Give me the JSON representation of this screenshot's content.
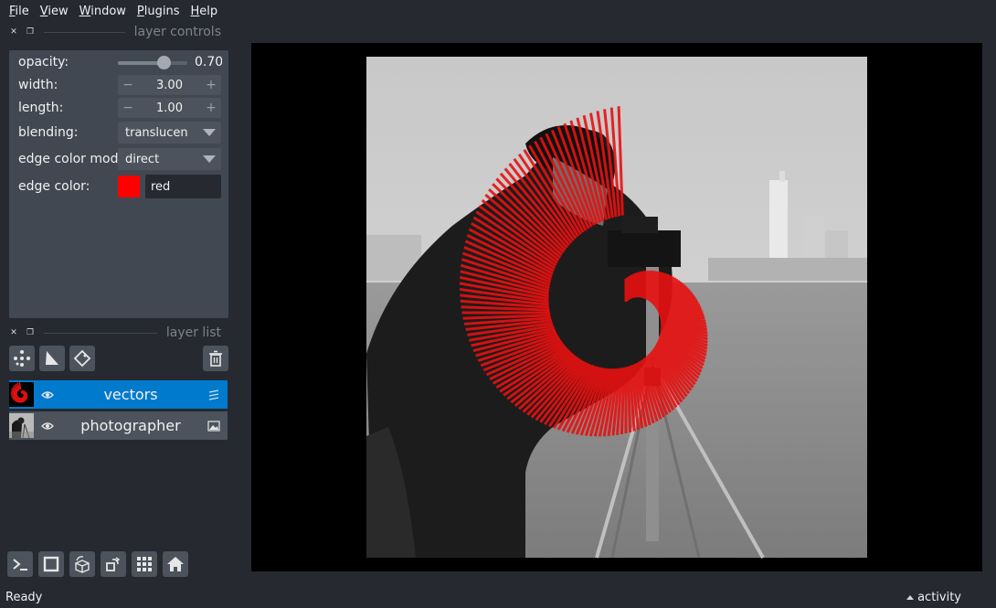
{
  "menubar": {
    "items": [
      {
        "mn": "F",
        "rest": "ile"
      },
      {
        "mn": "V",
        "rest": "iew"
      },
      {
        "mn": "W",
        "rest": "indow"
      },
      {
        "mn": "P",
        "rest": "lugins"
      },
      {
        "mn": "H",
        "rest": "elp"
      }
    ]
  },
  "layer_controls": {
    "title": "layer controls",
    "opacity": {
      "label": "opacity:",
      "value": "0.70",
      "level": 0.7
    },
    "width": {
      "label": "width:",
      "value": "3.00",
      "minus": "−",
      "plus": "+"
    },
    "length": {
      "label": "length:",
      "value": "1.00",
      "minus": "−",
      "plus": "+"
    },
    "blending": {
      "label": "blending:",
      "value": "translucen"
    },
    "edge_color_mode": {
      "label": "edge color mode:",
      "value": "direct"
    },
    "edge_color": {
      "label": "edge color:",
      "value": "red",
      "swatch": "#ff0000"
    }
  },
  "layer_list": {
    "title": "layer list",
    "layers": [
      {
        "name": "vectors",
        "selected": true,
        "type_icon": "vectors-icon"
      },
      {
        "name": "photographer",
        "selected": false,
        "type_icon": "image-icon"
      }
    ]
  },
  "status": {
    "text": "Ready",
    "activity": "activity"
  },
  "colors": {
    "background": "#262930",
    "panel": "#414851",
    "selected": "#007acc",
    "vector": "#ff0000"
  }
}
